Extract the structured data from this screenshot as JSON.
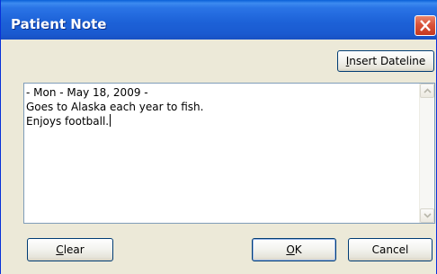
{
  "window": {
    "title": "Patient Note"
  },
  "toolbar": {
    "insert_dateline_pre": "I",
    "insert_dateline_rest": "nsert Dateline"
  },
  "note": {
    "lines": [
      "- Mon - May 18, 2009 -",
      "Goes to Alaska each year to fish.",
      "Enjoys football."
    ]
  },
  "buttons": {
    "clear_pre": "C",
    "clear_rest": "lear",
    "ok_pre": "O",
    "ok_rest": "K",
    "cancel": "Cancel"
  },
  "icons": {
    "close": "close-icon",
    "scroll_up": "scroll-up-arrow-icon",
    "scroll_down": "scroll-down-arrow-icon"
  },
  "colors": {
    "title_bar": "#1d62d8",
    "close_button": "#d9533a",
    "dialog_bg": "#ece9d8"
  }
}
